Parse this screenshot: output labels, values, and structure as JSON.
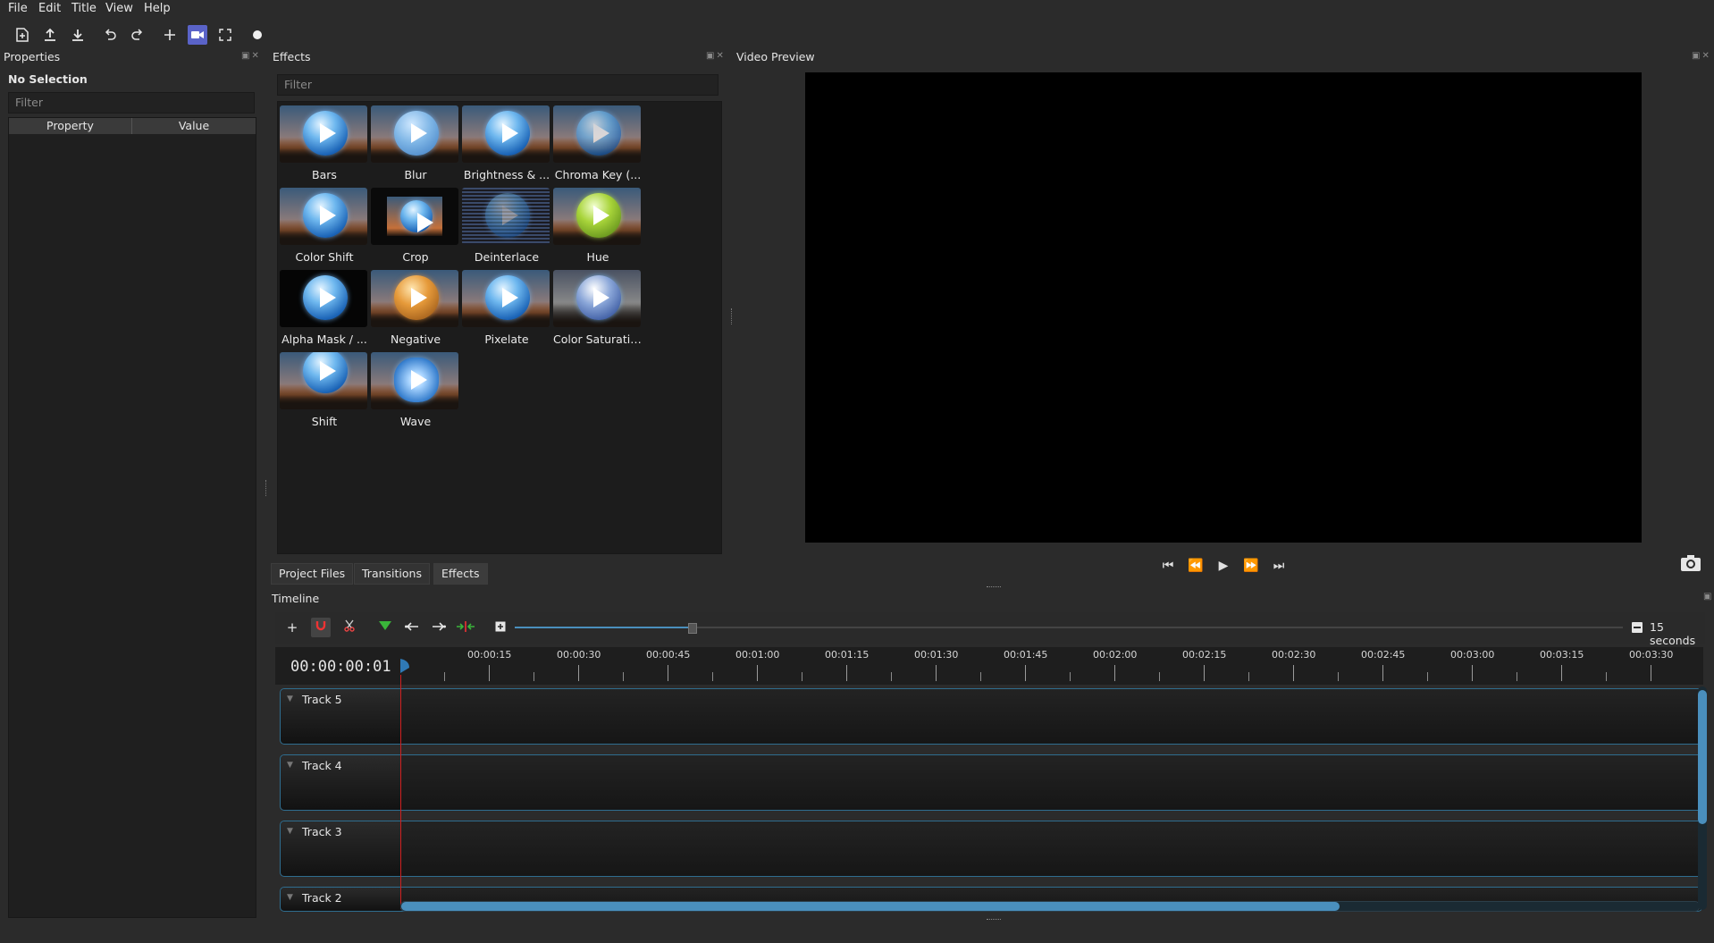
{
  "menu": [
    "File",
    "Edit",
    "Title",
    "View",
    "Help"
  ],
  "toolbar": {
    "icons": [
      "new-file-icon",
      "open-project-icon",
      "save-project-icon",
      "undo-icon",
      "redo-icon",
      "add-icon",
      "video-profile-icon",
      "fullscreen-icon",
      "record-icon"
    ]
  },
  "properties": {
    "title": "Properties",
    "selection": "No Selection",
    "filter_placeholder": "Filter",
    "col_property": "Property",
    "col_value": "Value"
  },
  "effects": {
    "title": "Effects",
    "filter_placeholder": "Filter",
    "items": [
      "Bars",
      "Blur",
      "Brightness & ...",
      "Chroma Key (...",
      "Color Shift",
      "Crop",
      "Deinterlace",
      "Hue",
      "Alpha Mask / ...",
      "Negative",
      "Pixelate",
      "Color Saturation",
      "Shift",
      "Wave"
    ]
  },
  "tabs": [
    "Project Files",
    "Transitions",
    "Effects"
  ],
  "video_preview": {
    "title": "Video Preview"
  },
  "timeline": {
    "title": "Timeline",
    "timecode": "00:00:00:01",
    "scale_label": "15 seconds",
    "zoom_level": 0.16,
    "ruler": [
      "00:00:15",
      "00:00:30",
      "00:00:45",
      "00:01:00",
      "00:01:15",
      "00:01:30",
      "00:01:45",
      "00:02:00",
      "00:02:15",
      "00:02:30",
      "00:02:45",
      "00:03:00",
      "00:03:15",
      "00:03:30"
    ],
    "tracks": [
      "Track 5",
      "Track 4",
      "Track 3",
      "Track 2"
    ]
  },
  "colors": {
    "accent": "#4a8fbd",
    "playhead": "#d02020",
    "track_border": "#2f6d8f"
  }
}
